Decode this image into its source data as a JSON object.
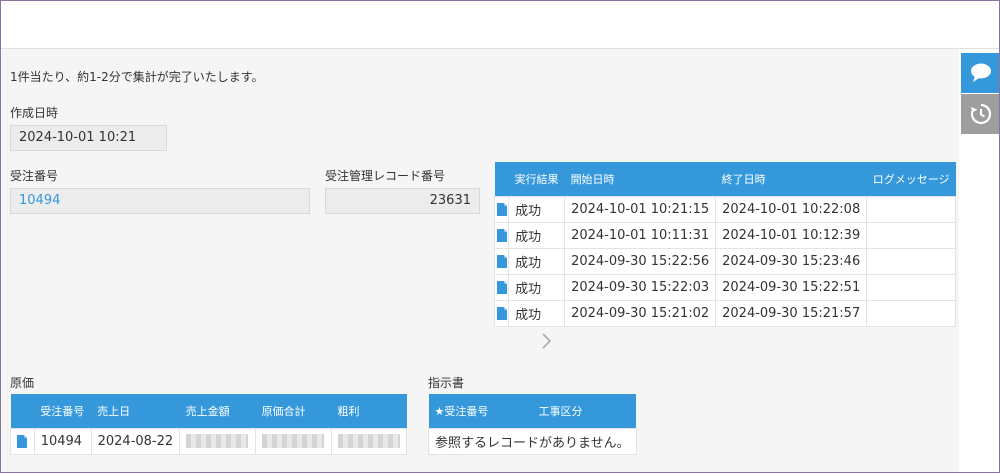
{
  "notice": "1件当たり、約1-2分で集計が完了いたします。",
  "created": {
    "label": "作成日時",
    "value": "2024-10-01 10:21"
  },
  "order_no": {
    "label": "受注番号",
    "value": "10494"
  },
  "order_record": {
    "label": "受注管理レコード番号",
    "value": "23631"
  },
  "log_table": {
    "headers": [
      "実行結果",
      "開始日時",
      "終了日時",
      "ログメッセージ"
    ],
    "rows": [
      {
        "result": "成功",
        "start": "2024-10-01 10:21:15",
        "end": "2024-10-01 10:22:08",
        "message": ""
      },
      {
        "result": "成功",
        "start": "2024-10-01 10:11:31",
        "end": "2024-10-01 10:12:39",
        "message": ""
      },
      {
        "result": "成功",
        "start": "2024-09-30 15:22:56",
        "end": "2024-09-30 15:23:46",
        "message": ""
      },
      {
        "result": "成功",
        "start": "2024-09-30 15:22:03",
        "end": "2024-09-30 15:22:51",
        "message": ""
      },
      {
        "result": "成功",
        "start": "2024-09-30 15:21:02",
        "end": "2024-09-30 15:21:57",
        "message": ""
      }
    ]
  },
  "cost": {
    "label": "原価",
    "headers": [
      "受注番号",
      "売上日",
      "売上金額",
      "原価合計",
      "粗利"
    ],
    "row": {
      "order_no": "10494",
      "sales_date": "2024-08-22"
    }
  },
  "instruction": {
    "label": "指示書",
    "headers": [
      "★受注番号",
      "工事区分"
    ],
    "empty_message": "参照するレコードがありません。"
  },
  "icons": {
    "file": "file-icon",
    "comment": "comment-icon",
    "history": "history-icon",
    "next": "chevron-right-icon"
  },
  "colors": {
    "accent": "#3498db",
    "side_comment": "#3498db",
    "side_history": "#9e9e9e"
  }
}
